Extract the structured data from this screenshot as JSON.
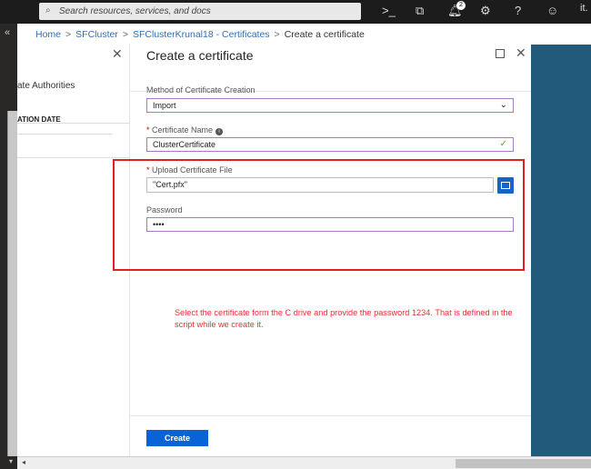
{
  "topbar": {
    "search_placeholder": "Search resources, services, and docs",
    "notification_count": "2",
    "account": "it."
  },
  "breadcrumb": {
    "items": [
      "Home",
      "SFCluster",
      "SFClusterKrunal18 - Certificates"
    ],
    "current": "Create a certificate",
    "separator": ">"
  },
  "left_blade": {
    "item": "ate Authorities",
    "column_header": "ATION DATE"
  },
  "blade": {
    "title": "Create a certificate",
    "method_label": "Method of Certificate Creation",
    "method_value": "Import",
    "name_label": "Certificate Name",
    "name_value": "ClusterCertificate",
    "upload_label": "Upload Certificate File",
    "upload_value": "\"Cert.pfx\"",
    "password_label": "Password",
    "password_value": "••••",
    "required_marker": "*",
    "create_label": "Create"
  },
  "annotation": "Select the certificate form the C drive and provide the password 1234. That is defined in the script while we create it.",
  "colors": {
    "accent": "#0a63d6",
    "annotation": "#e02020",
    "right_panel": "#225a7c"
  }
}
